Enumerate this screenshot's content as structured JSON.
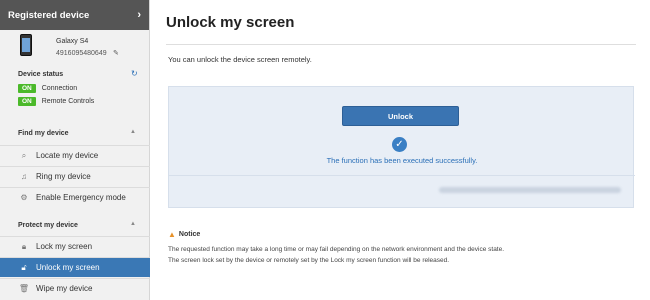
{
  "sidebar": {
    "header": {
      "title": "Registered device",
      "chevron": "›"
    },
    "device": {
      "name": "Galaxy S4",
      "number": "4916095480649"
    },
    "status": {
      "title": "Device status",
      "rows": [
        {
          "badge": "ON",
          "label": "Connection"
        },
        {
          "badge": "ON",
          "label": "Remote Controls"
        }
      ]
    },
    "find": {
      "title": "Find my device",
      "items": [
        "Locate my device",
        "Ring my device",
        "Enable Emergency mode"
      ]
    },
    "protect": {
      "title": "Protect my device",
      "items": [
        "Lock my screen",
        "Unlock my screen",
        "Wipe my device"
      ]
    }
  },
  "main": {
    "title": "Unlock my screen",
    "description": "You can unlock the device screen remotely.",
    "unlock_button": "Unlock",
    "success_message": "The function has been executed successfully.",
    "notice": {
      "title": "Notice",
      "lines": [
        "The requested function may take a long time or may fail depending on the network environment and the device state.",
        "The screen lock set by the device or remotely set by the Lock my screen function will be released."
      ]
    }
  },
  "colors": {
    "accent": "#3a78b5",
    "on_badge": "#4bb92a",
    "panel": "#e8eef6"
  }
}
